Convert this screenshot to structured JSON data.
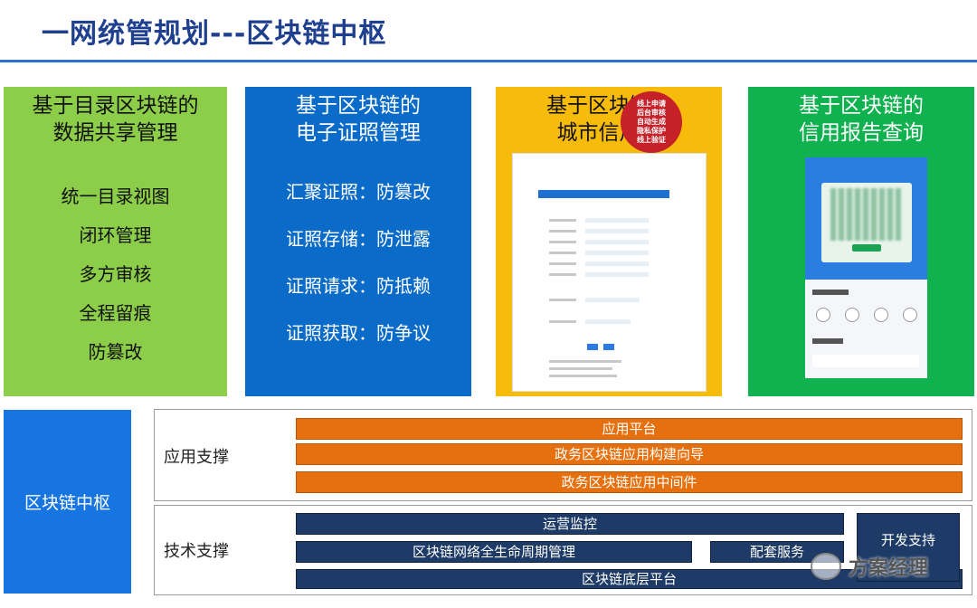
{
  "title": "一网统管规划---区块链中枢",
  "colors": {
    "green": "#8ccd4a",
    "blue": "#0b6bc8",
    "yellow": "#f7bb0b",
    "darkgreen": "#10b14f",
    "orange": "#e6700e",
    "navy": "#1e3a66",
    "hub": "#1675e0"
  },
  "cards": [
    {
      "title_l1": "基于目录区块链的",
      "title_l2": "数据共享管理",
      "items": [
        "统一目录视图",
        "闭环管理",
        "多方审核",
        "全程留痕",
        "防篡改"
      ]
    },
    {
      "title_l1": "基于区块链的",
      "title_l2": "电子证照管理",
      "items": [
        "汇聚证照：防篡改",
        "证照存储：防泄露",
        "证照请求：防抵赖",
        "证照获取：防争议"
      ]
    },
    {
      "title_l1": "基于区块链的",
      "title_l2": "城市信用码",
      "badge": [
        "线上申请",
        "后台审核",
        "自动生成",
        "隐私保护",
        "线上验证"
      ]
    },
    {
      "title_l1": "基于区块链的",
      "title_l2": "信用报告查询"
    }
  ],
  "hub": "区块链中枢",
  "app_support": {
    "label": "应用支撑",
    "bars": [
      "应用平台",
      "政务区块链应用构建向导",
      "政务区块链应用中间件"
    ]
  },
  "tech_support": {
    "label": "技术支撑",
    "ops": "运营监控",
    "lifecycle": "区块链网络全生命周期管理",
    "services": "配套服务",
    "base": "区块链底层平台",
    "dev": "开发支持"
  },
  "watermark": "方案经理"
}
